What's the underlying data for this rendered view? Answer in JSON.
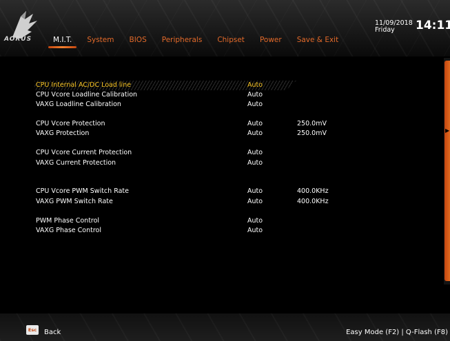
{
  "header": {
    "brand": "AORUS",
    "date": "11/09/2018",
    "day": "Friday",
    "time": "14:11",
    "tabs": [
      {
        "label": "M.I.T.",
        "active": true
      },
      {
        "label": "System",
        "active": false
      },
      {
        "label": "BIOS",
        "active": false
      },
      {
        "label": "Peripherals",
        "active": false
      },
      {
        "label": "Chipset",
        "active": false
      },
      {
        "label": "Power",
        "active": false
      },
      {
        "label": "Save & Exit",
        "active": false
      }
    ]
  },
  "settings": [
    {
      "label": "CPU Internal AC/DC Load line",
      "value": "Auto",
      "extra": "",
      "selected": true
    },
    {
      "label": "CPU Vcore Loadline Calibration",
      "value": "Auto",
      "extra": ""
    },
    {
      "label": "VAXG Loadline Calibration",
      "value": "Auto",
      "extra": ""
    },
    {
      "label": "CPU Vcore Protection",
      "value": "Auto",
      "extra": "250.0mV"
    },
    {
      "label": "VAXG Protection",
      "value": "Auto",
      "extra": "250.0mV"
    },
    {
      "label": "CPU Vcore Current Protection",
      "value": "Auto",
      "extra": ""
    },
    {
      "label": "VAXG Current Protection",
      "value": "Auto",
      "extra": ""
    },
    {
      "label": "CPU Vcore PWM Switch Rate",
      "value": "Auto",
      "extra": "400.0KHz"
    },
    {
      "label": "VAXG PWM Switch Rate",
      "value": "Auto",
      "extra": "400.0KHz"
    },
    {
      "label": "PWM Phase Control",
      "value": "Auto",
      "extra": ""
    },
    {
      "label": "VAXG Phase Control",
      "value": "Auto",
      "extra": ""
    }
  ],
  "footer": {
    "esc_key": "Esc",
    "back_label": "Back",
    "shortcuts": "Easy Mode (F2) | Q-Flash (F8)"
  },
  "colors": {
    "accent": "#e36a2a",
    "selected": "#f4c020",
    "text": "#ffffff"
  }
}
